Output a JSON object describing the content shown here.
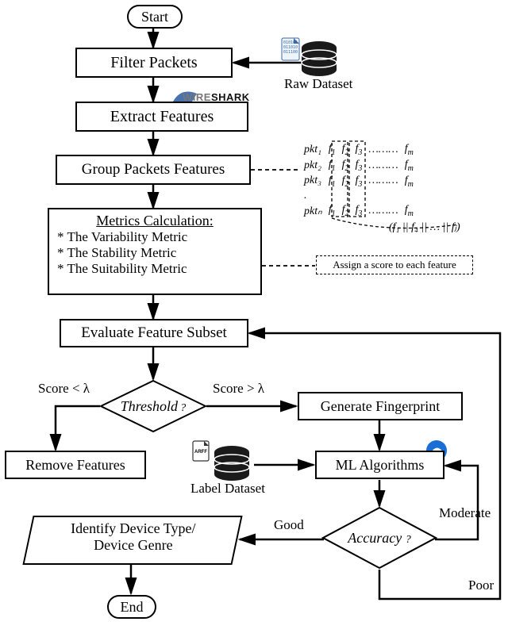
{
  "nodes": {
    "start": "Start",
    "filter": "Filter Packets",
    "extract": "Extract Features",
    "group": "Group Packets Features",
    "metrics_title": "Metrics Calculation:",
    "metrics_items": [
      "* The Variability Metric",
      "* The Stability Metric",
      "* The Suitability Metric"
    ],
    "evaluate": "Evaluate Feature Subset",
    "threshold": "Threshold",
    "remove": "Remove Features",
    "generate": "Generate Fingerprint",
    "ml": "ML Algorithms",
    "accuracy": "Accuracy",
    "identify_l1": "Identify Device Type/",
    "identify_l2": "Device Genre",
    "end": "End"
  },
  "labels": {
    "raw_dataset": "Raw Dataset",
    "label_dataset": "Label Dataset",
    "wireshark_a": "WIRE",
    "wireshark_b": "SHARK",
    "score_lt": "Score < λ",
    "score_gt": "Score > λ",
    "good": "Good",
    "moderate": "Moderate",
    "poor": "Poor",
    "q": "?",
    "assign": "Assign a score to each feature",
    "arff": "ARFF",
    "binary": "010101\n011010\n011100"
  },
  "matrix": {
    "rows": [
      "pkt₁",
      "pkt₂",
      "pkt₃",
      ".",
      "pktₙ"
    ],
    "cols_sample": "f₁  f₂  f₃  ……… fₘ",
    "concat": "(f₁ || f₄ || … || fⱼ)"
  }
}
